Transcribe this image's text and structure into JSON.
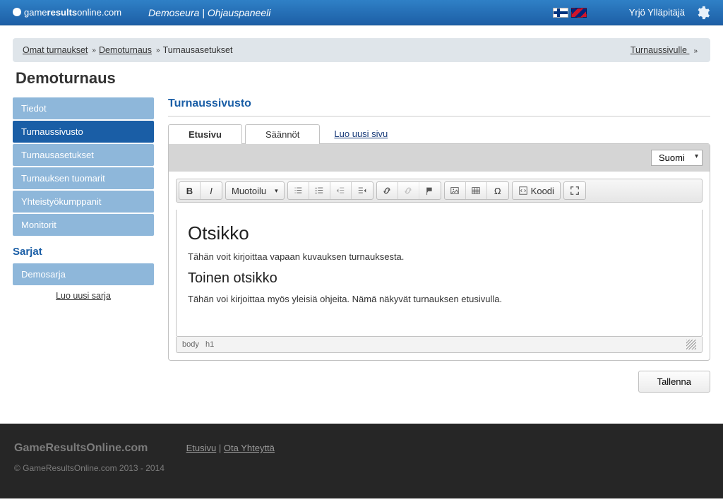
{
  "header": {
    "brand_game": "game",
    "brand_results": "results",
    "brand_online": "online.com",
    "org": "Demoseura",
    "panel": "Ohjauspaneeli",
    "user": "Yrjö Ylläpitäjä"
  },
  "breadcrumb": {
    "own_tournaments": "Omat turnaukset",
    "demo_tournament": "Demoturnaus",
    "tournament_settings": "Turnausasetukset",
    "right_link": "Turnaussivulle "
  },
  "page_title": "Demoturnaus",
  "sidebar": {
    "items": [
      {
        "label": "Tiedot"
      },
      {
        "label": "Turnaussivusto"
      },
      {
        "label": "Turnausasetukset"
      },
      {
        "label": "Turnauksen tuomarit"
      },
      {
        "label": "Yhteistyökumppanit"
      },
      {
        "label": "Monitorit"
      }
    ],
    "series_head": "Sarjat",
    "series_items": [
      {
        "label": "Demosarja"
      }
    ],
    "new_series": "Luo uusi sarja"
  },
  "main": {
    "section_title": "Turnaussivusto",
    "tabs": [
      {
        "label": "Etusivu"
      },
      {
        "label": "Säännöt"
      }
    ],
    "new_page_link": "Luo uusi sivu",
    "language_select": "Suomi",
    "format_dropdown": "Muotoilu",
    "code_button": "Koodi",
    "content": {
      "h1": "Otsikko",
      "p1": "Tähän voit kirjoittaa vapaan kuvauksen turnauksesta.",
      "h2": "Toinen otsikko",
      "p2": "Tähän voi kirjoittaa myös yleisiä ohjeita. Nämä näkyvät turnauksen etusivulla."
    },
    "path": {
      "body": "body",
      "h1": "h1"
    },
    "save": "Tallenna"
  },
  "footer": {
    "brand": "GameResultsOnline.com",
    "home": "Etusivu",
    "contact": "Ota Yhteyttä",
    "copyright": "© GameResultsOnline.com 2013 - 2014"
  }
}
